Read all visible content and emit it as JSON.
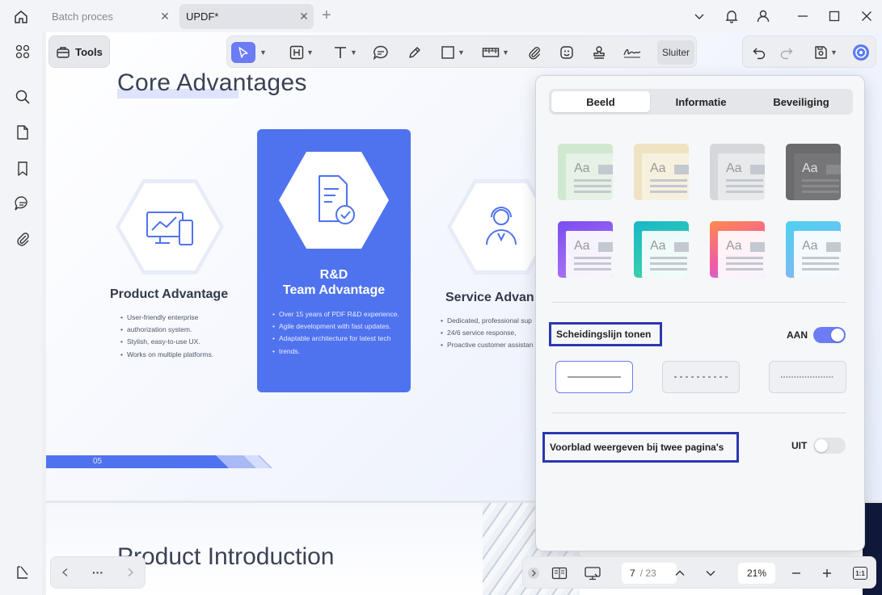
{
  "titlebar": {
    "tabs": [
      {
        "label": "Batch proces",
        "close": "✕"
      },
      {
        "label": "UPDF*",
        "close": "✕"
      }
    ],
    "add_tab": "+"
  },
  "toolbar": {
    "tools_label": "Tools",
    "close_label": "Sluiter"
  },
  "document": {
    "slide1": {
      "title": "Core Advantages",
      "page_number": "05",
      "cards": [
        {
          "title": "Product Advantage",
          "bullets": [
            "User-friendly enterprise",
            "authorization system.",
            "Stylish, easy-to-use UX.",
            "Works on multiple platforms."
          ]
        },
        {
          "title_line1": "R&D",
          "title_line2": "Team Advantage",
          "bullets": [
            "Over 15 years of PDF R&D experience.",
            "Agile development with fast updates.",
            "Adaptable architecture for latest tech",
            "trends."
          ]
        },
        {
          "title": "Service Advan",
          "bullets": [
            "Dedicated, professional sup",
            "24/6 service response,",
            "Proactive customer assistan"
          ]
        }
      ]
    },
    "slide2": {
      "title": "Product Introduction"
    }
  },
  "panel": {
    "tabs": [
      "Beeld",
      "Informatie",
      "Beveiliging"
    ],
    "active_tab": "Beeld",
    "themes": [
      {
        "name": "green",
        "bg": "#cfe8cf"
      },
      {
        "name": "beige",
        "bg": "#efe3c4"
      },
      {
        "name": "gray",
        "bg": "#d6d7da"
      },
      {
        "name": "dark",
        "bg": "#6b6b6e"
      },
      {
        "name": "purple",
        "bg": "#8d5cf0"
      },
      {
        "name": "teal",
        "bg": "#2cc4c4"
      },
      {
        "name": "pink-orange",
        "bg": "#f06f9a"
      },
      {
        "name": "sky",
        "bg": "#63c9ee"
      }
    ],
    "theme_label": "Aa",
    "divider_option": {
      "label": "Scheidingslijn tonen",
      "state": "AAN",
      "on": true
    },
    "line_styles": [
      "solid",
      "dashed",
      "dotted"
    ],
    "cover_option": {
      "label": "Voorblad weergeven bij twee pagina's",
      "state": "UIT",
      "on": false
    },
    "accent": "#6b7cf5"
  },
  "navbar": {
    "more": "···"
  },
  "statusbar": {
    "current_page": "7",
    "separator_total": "/ 23",
    "zoom": "21%",
    "fit_label": "1:1"
  }
}
